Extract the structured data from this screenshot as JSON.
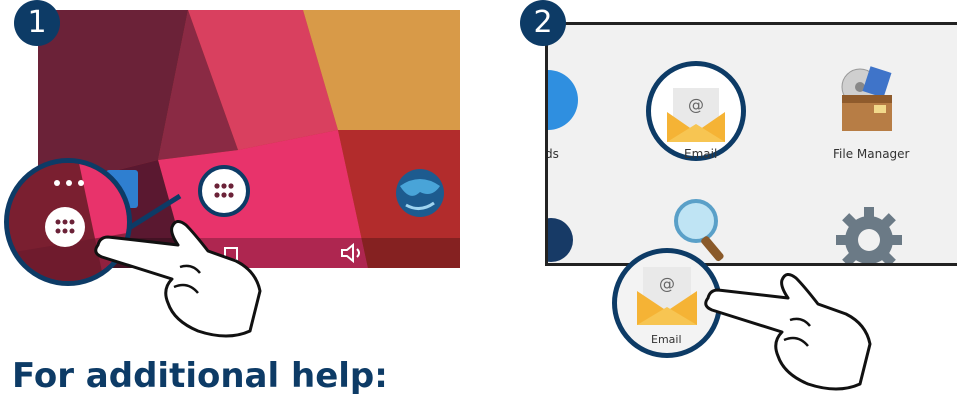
{
  "steps": [
    {
      "number": "1"
    },
    {
      "number": "2"
    }
  ],
  "app_drawer": {
    "apps": [
      {
        "label": "Email",
        "icon": "email-icon"
      },
      {
        "label": "File Manager",
        "icon": "file-manager-icon"
      },
      {
        "label": "ds",
        "icon": "partial-app-icon"
      }
    ],
    "callout_label": "Email"
  },
  "nav_icons": [
    "recent-apps-icon",
    "volume-icon"
  ],
  "heading": "For additional help:",
  "colors": {
    "badge": "#0d3b66",
    "ring": "#0d3b66",
    "wallpaper_pink": "#e8336b",
    "wallpaper_orange": "#d89a48",
    "wallpaper_red": "#b53232"
  }
}
